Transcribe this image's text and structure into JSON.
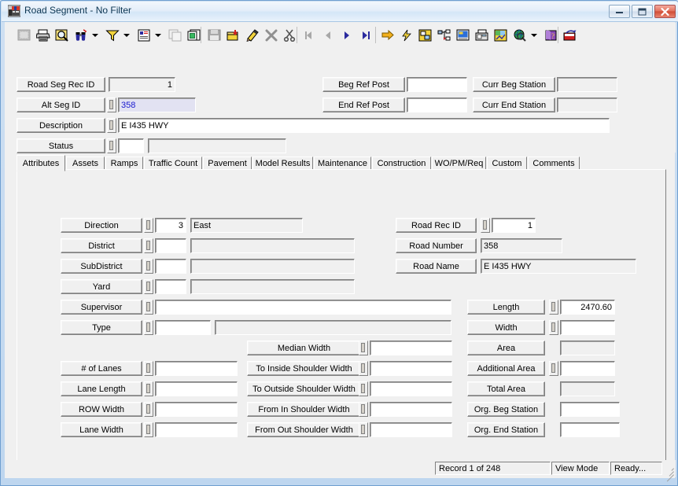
{
  "window": {
    "title": "Road Segment - No Filter",
    "icon": "app-icon",
    "buttons": {
      "minimize": "–",
      "maximize": "□",
      "close": "✕"
    }
  },
  "toolbar": {
    "groups": [
      {
        "items": [
          {
            "name": "print-preview-grid-icon",
            "glyph": "▒",
            "disabled": true,
            "dropdown": false
          },
          {
            "name": "print-icon",
            "glyph": "🖨",
            "disabled": false,
            "dropdown": false
          },
          {
            "name": "search-magnifier-icon",
            "glyph": "🔍",
            "disabled": false,
            "dropdown": false
          },
          {
            "name": "find-binoculars-icon",
            "glyph": "🔭",
            "disabled": false,
            "dropdown": true
          },
          {
            "name": "filter-funnel-icon",
            "glyph": "▽",
            "disabled": false,
            "dropdown": true
          },
          {
            "name": "report-icon",
            "glyph": "📄",
            "disabled": false,
            "dropdown": true
          },
          {
            "name": "copy-record-icon",
            "glyph": "❐",
            "disabled": true,
            "dropdown": false
          },
          {
            "name": "duplicate-icon",
            "glyph": "⧉",
            "disabled": false,
            "dropdown": false
          }
        ]
      },
      {
        "items": [
          {
            "name": "save-icon",
            "glyph": "💾",
            "disabled": true,
            "dropdown": false
          },
          {
            "name": "add-record-icon",
            "glyph": "➕",
            "disabled": false,
            "dropdown": false
          },
          {
            "name": "edit-pencil-icon",
            "glyph": "✎",
            "disabled": false,
            "dropdown": false
          },
          {
            "name": "cancel-x-icon",
            "glyph": "✕",
            "disabled": true,
            "dropdown": false
          },
          {
            "name": "cut-scissors-icon",
            "glyph": "✂",
            "disabled": false,
            "dropdown": false
          }
        ]
      },
      {
        "items": [
          {
            "name": "first-record-icon",
            "glyph": "◀|",
            "disabled": true,
            "dropdown": false
          },
          {
            "name": "previous-record-icon",
            "glyph": "◀",
            "disabled": true,
            "dropdown": false
          },
          {
            "name": "next-record-icon",
            "glyph": "▶",
            "disabled": false,
            "dropdown": false
          },
          {
            "name": "last-record-icon",
            "glyph": "|▶",
            "disabled": false,
            "dropdown": false
          }
        ]
      },
      {
        "items": [
          {
            "name": "go-to-icon",
            "glyph": "➡",
            "disabled": false,
            "dropdown": false
          },
          {
            "name": "lightning-action-icon",
            "glyph": "⚡",
            "disabled": false,
            "dropdown": false
          },
          {
            "name": "layout-designer-icon",
            "glyph": "▦",
            "disabled": false,
            "dropdown": false
          },
          {
            "name": "hierarchy-tree-icon",
            "glyph": "⑂",
            "disabled": false,
            "dropdown": false
          },
          {
            "name": "monitor-screen-icon",
            "glyph": "🖵",
            "disabled": false,
            "dropdown": false
          },
          {
            "name": "fax-machine-icon",
            "glyph": "📠",
            "disabled": false,
            "dropdown": false
          },
          {
            "name": "map-chart-icon",
            "glyph": "🗺",
            "disabled": false,
            "dropdown": false
          },
          {
            "name": "globe-search-icon",
            "glyph": "🌐",
            "disabled": false,
            "dropdown": true
          },
          {
            "name": "help-book-icon",
            "glyph": "📘",
            "disabled": false,
            "dropdown": false
          }
        ]
      },
      {
        "items": [
          {
            "name": "exit-door-icon",
            "glyph": "↩",
            "disabled": false,
            "dropdown": false
          }
        ]
      }
    ]
  },
  "header": {
    "left": [
      {
        "label": "Road Seg Rec ID",
        "value": "1",
        "spinner": false,
        "readonly": true,
        "align": "right"
      },
      {
        "label": "Alt Seg ID",
        "value": "358",
        "spinner": true,
        "readonly": false,
        "selected": true
      },
      {
        "label": "Description",
        "value": "E I435 HWY",
        "spinner": true,
        "readonly": false
      },
      {
        "label": "Status",
        "value": "",
        "value2": "",
        "spinner": true,
        "readonly": false
      }
    ],
    "middle": [
      {
        "label": "Beg Ref Post",
        "value": ""
      },
      {
        "label": "End Ref Post",
        "value": ""
      }
    ],
    "right": [
      {
        "label": "Curr Beg Station",
        "value": ""
      },
      {
        "label": "Curr End Station",
        "value": ""
      }
    ]
  },
  "tabs": [
    {
      "label": "Attributes",
      "active": true
    },
    {
      "label": "Assets",
      "active": false
    },
    {
      "label": "Ramps",
      "active": false
    },
    {
      "label": "Traffic Count",
      "active": false
    },
    {
      "label": "Pavement",
      "active": false
    },
    {
      "label": "Model Results",
      "active": false
    },
    {
      "label": "Maintenance",
      "active": false
    },
    {
      "label": "Construction",
      "active": false
    },
    {
      "label": "WO/PM/Req",
      "active": false
    },
    {
      "label": "Custom",
      "active": false
    },
    {
      "label": "Comments",
      "active": false
    }
  ],
  "attributes": {
    "col1": [
      {
        "label": "Direction",
        "spinner": true,
        "code": "3",
        "desc": "East"
      },
      {
        "label": "District",
        "spinner": true,
        "code": "",
        "desc": ""
      },
      {
        "label": "SubDistrict",
        "spinner": true,
        "code": "",
        "desc": ""
      },
      {
        "label": "Yard",
        "spinner": true,
        "code": "",
        "desc": ""
      },
      {
        "label": "Supervisor",
        "spinner": true,
        "code": "",
        "desc": null
      },
      {
        "label": "Type",
        "spinner": true,
        "code": "",
        "desc": ""
      }
    ],
    "col1b": [
      {
        "label": "# of Lanes",
        "spinner": true,
        "value": ""
      },
      {
        "label": "Lane Length",
        "spinner": true,
        "value": ""
      },
      {
        "label": "ROW Width",
        "spinner": true,
        "value": ""
      },
      {
        "label": "Lane Width",
        "spinner": true,
        "value": ""
      }
    ],
    "col2": [
      {
        "label": "Median Width",
        "spinner": true,
        "value": ""
      },
      {
        "label": "To Inside Shoulder Width",
        "spinner": true,
        "value": ""
      },
      {
        "label": "To Outside Shoulder Width",
        "spinner": true,
        "value": ""
      },
      {
        "label": "From In Shoulder Width",
        "spinner": true,
        "value": ""
      },
      {
        "label": "From Out Shoulder Width",
        "spinner": true,
        "value": ""
      }
    ],
    "col3top": [
      {
        "label": "Road Rec ID",
        "spinner": true,
        "value": "1",
        "readonly": false,
        "align": "right"
      },
      {
        "label": "Road Number",
        "spinner": false,
        "value": "358",
        "readonly": true,
        "align": "left"
      },
      {
        "label": "Road Name",
        "spinner": false,
        "value": "E I435 HWY",
        "readonly": true,
        "align": "left"
      }
    ],
    "col3": [
      {
        "label": "Length",
        "spinner": true,
        "value": "2470.60",
        "readonly": false,
        "align": "right"
      },
      {
        "label": "Width",
        "spinner": true,
        "value": "",
        "readonly": false,
        "align": "right"
      },
      {
        "label": "Area",
        "spinner": false,
        "value": "",
        "readonly": true,
        "align": "right"
      },
      {
        "label": "Additional Area",
        "spinner": true,
        "value": "",
        "readonly": false,
        "align": "right"
      },
      {
        "label": "Total Area",
        "spinner": false,
        "value": "",
        "readonly": true,
        "align": "right"
      },
      {
        "label": "Org. Beg Station",
        "spinner": false,
        "value": "",
        "readonly": false,
        "align": "left"
      },
      {
        "label": "Org. End Station",
        "spinner": false,
        "value": "",
        "readonly": false,
        "align": "left"
      }
    ]
  },
  "statusbar": {
    "record": "Record 1 of 248",
    "mode": "View Mode",
    "state": "Ready..."
  },
  "colors": {
    "face": "#f0f0f0",
    "frame": "#bed6ef",
    "selection_bg": "#e2e2f2",
    "selection_fg": "#1a1ad0",
    "title_text": "#0b3552"
  }
}
